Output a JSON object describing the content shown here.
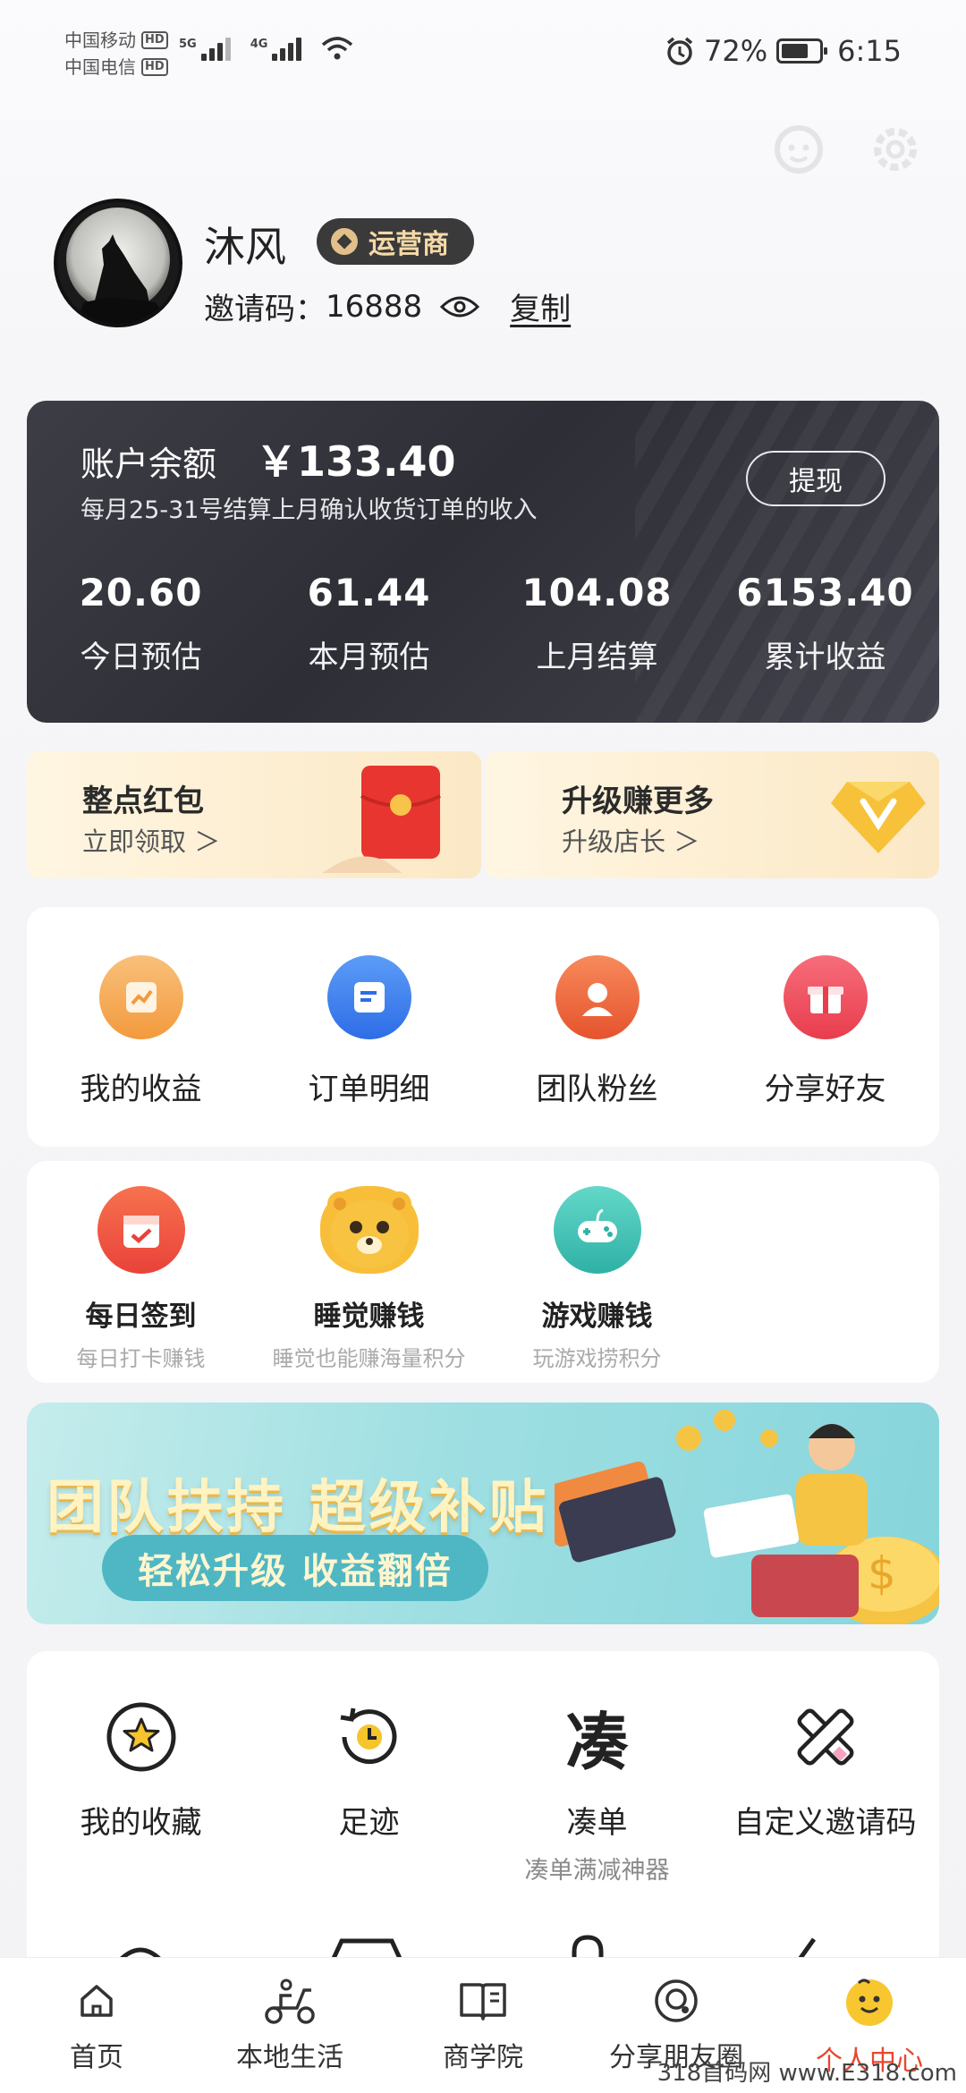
{
  "status_bar": {
    "carrier1": "中国移动",
    "carrier2": "中国电信",
    "hd": "HD",
    "net1": "5G",
    "net2": "4G",
    "battery_pct": "72%",
    "battery_level": 0.72,
    "time": "6:15",
    "icons": [
      "alarm-icon",
      "wifi-icon",
      "signal-icon",
      "battery-icon"
    ]
  },
  "header": {
    "icons": [
      "customer-service-icon",
      "settings-icon"
    ]
  },
  "profile": {
    "name": "沐风",
    "badge": "运营商",
    "invite_label": "邀请码：",
    "invite_code": "16888",
    "copy": "复制"
  },
  "balance": {
    "label": "账户余额",
    "amount": "￥133.40",
    "note": "每月25-31号结算上月确认收货订单的收入",
    "withdraw": "提现",
    "stats": [
      {
        "value": "20.60",
        "label": "今日预估"
      },
      {
        "value": "61.44",
        "label": "本月预估"
      },
      {
        "value": "104.08",
        "label": "上月结算"
      },
      {
        "value": "6153.40",
        "label": "累计收益"
      }
    ]
  },
  "promos": [
    {
      "title": "整点红包",
      "subtitle": "立即领取 ＞"
    },
    {
      "title": "升级赚更多",
      "subtitle": "升级店长 ＞"
    }
  ],
  "main_menu": [
    {
      "label": "我的收益",
      "icon": "earnings-icon",
      "color": "#f6a24b"
    },
    {
      "label": "订单明细",
      "icon": "order-icon",
      "color": "#3c7ef2"
    },
    {
      "label": "团队粉丝",
      "icon": "team-icon",
      "color": "#f06a3a"
    },
    {
      "label": "分享好友",
      "icon": "gift-icon",
      "color": "#f15160"
    }
  ],
  "tasks": [
    {
      "title": "每日签到",
      "subtitle": "每日打卡赚钱",
      "icon": "calendar-icon"
    },
    {
      "title": "睡觉赚钱",
      "subtitle": "睡觉也能赚海量积分",
      "icon": "bear-icon"
    },
    {
      "title": "游戏赚钱",
      "subtitle": "玩游戏捞积分",
      "icon": "gamepad-icon"
    }
  ],
  "banner": {
    "title": "团队扶持 超级补贴",
    "pill": "轻松升级 收益翻倍"
  },
  "tools": [
    {
      "label": "我的收藏",
      "sub": "",
      "icon": "star-icon"
    },
    {
      "label": "足迹",
      "sub": "",
      "icon": "clock-icon"
    },
    {
      "label": "凑单",
      "sub": "凑单满减神器",
      "icon": "coudan-icon",
      "glyph": "凑"
    },
    {
      "label": "自定义邀请码",
      "sub": "",
      "icon": "pencil-icon"
    }
  ],
  "bottom_nav": [
    {
      "label": "首页",
      "icon": "home-icon"
    },
    {
      "label": "本地生活",
      "icon": "scooter-icon"
    },
    {
      "label": "商学院",
      "icon": "book-icon"
    },
    {
      "label": "分享朋友圈",
      "icon": "moments-icon"
    },
    {
      "label": "个人中心",
      "icon": "profile-icon",
      "active": true
    }
  ],
  "watermark": "318首码网 www.E318.com"
}
